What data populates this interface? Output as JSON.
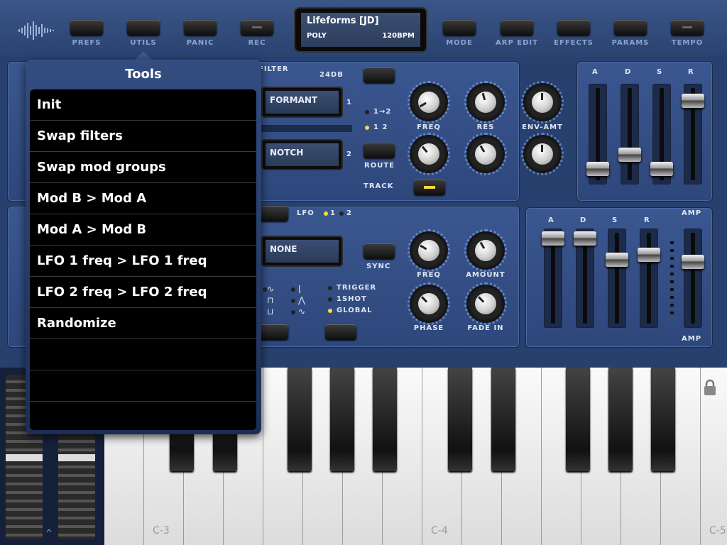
{
  "topbar": {
    "buttons": [
      {
        "label": "PREFS"
      },
      {
        "label": "UTILS"
      },
      {
        "label": "PANIC"
      },
      {
        "label": "REC"
      },
      {
        "label": "MODE"
      },
      {
        "label": "ARP EDIT"
      },
      {
        "label": "EFFECTS"
      },
      {
        "label": "PARAMS"
      },
      {
        "label": "TEMPO"
      }
    ],
    "display": {
      "patch_name": "Lifeforms [JD]",
      "voice_mode": "POLY",
      "tempo": "120BPM"
    }
  },
  "filter": {
    "section_label": "FILTER",
    "slope_label": "24DB",
    "filter1_type": "FORMANT",
    "filter1_num": "1",
    "filter2_type": "NOTCH",
    "filter2_num": "2",
    "route_label": "ROUTE",
    "track_label": "TRACK",
    "route_options": [
      "1→2",
      "1 2"
    ],
    "knob_labels": [
      "FREQ",
      "RES",
      "ENV-AMT"
    ],
    "env_labels": [
      "A",
      "D",
      "S",
      "R"
    ]
  },
  "lfo": {
    "section_label": "LFO",
    "select_1": "1",
    "select_2": "2",
    "target": "NONE",
    "sync_label": "SYNC",
    "knob_labels": [
      "FREQ",
      "AMOUNT",
      "PHASE",
      "FADE IN"
    ],
    "modes": [
      "TRIGGER",
      "1SHOT",
      "GLOBAL"
    ],
    "active_mode": "GLOBAL"
  },
  "amp": {
    "section_label": "AMP",
    "env_labels": [
      "A",
      "D",
      "S",
      "R"
    ],
    "fader_label": "AMP"
  },
  "keyboard": {
    "notes": [
      "C-3",
      "C-4",
      "C-5"
    ]
  },
  "tools_popover": {
    "title": "Tools",
    "items": [
      "Init",
      "Swap filters",
      "Swap mod groups",
      "Mod B > Mod A",
      "Mod A > Mod B",
      "LFO 1 freq > LFO 1 freq",
      "LFO 2 freq > LFO 2 freq",
      "Randomize",
      "",
      "",
      ""
    ]
  },
  "icons": {
    "logo": "waveform-logo-icon",
    "lock": "lock-icon"
  },
  "colors": {
    "panel": "#34508a",
    "led_on": "#ffd83a",
    "popover_bg": "#000000"
  }
}
